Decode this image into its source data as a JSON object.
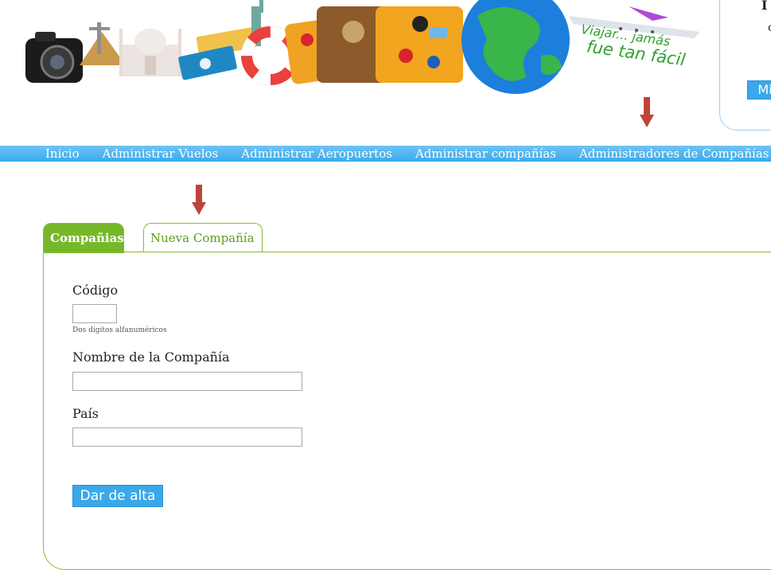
{
  "banner": {
    "slogan_line1": "Viajar... jamás",
    "slogan_line2": "fue tan fácil",
    "slogan_color": "#2ea12e",
    "user_button_label": "Mi",
    "userbox_text1": "I",
    "userbox_text2": "c"
  },
  "menu": {
    "items": [
      {
        "label": "Inicio"
      },
      {
        "label": "Administrar Vuelos"
      },
      {
        "label": "Administrar Aeropuertos"
      },
      {
        "label": "Administrar compañías"
      },
      {
        "label": "Administradores de Compañías"
      }
    ],
    "bar_color": "#3aa9ec"
  },
  "tabs": [
    {
      "label": "Compañias",
      "active": true
    },
    {
      "label": "Nueva Compañía",
      "active": false
    }
  ],
  "form": {
    "code_label": "Código",
    "code_value": "",
    "code_hint": "Dos digitos alfanuméricos",
    "name_label": "Nombre de la Compañía",
    "name_value": "",
    "country_label": "País",
    "country_value": "",
    "submit_label": "Dar de alta"
  },
  "colors": {
    "accent_green": "#76b82a",
    "button_blue": "#3aa8ea",
    "arrow_red": "#c0443a"
  }
}
